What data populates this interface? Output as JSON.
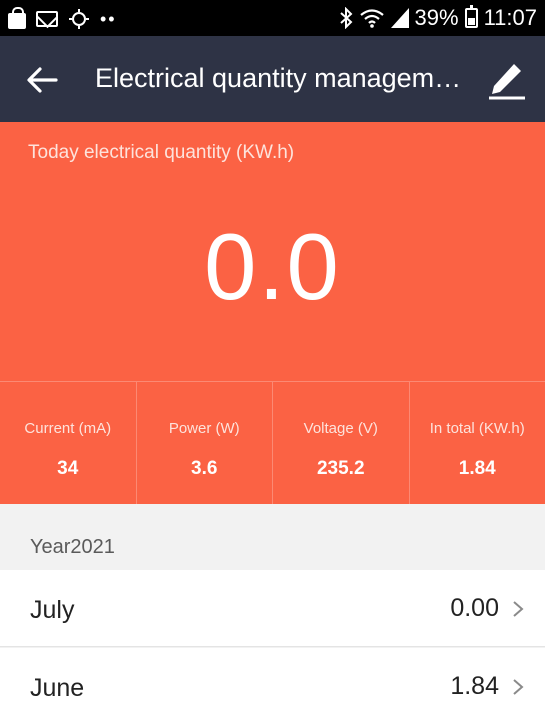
{
  "status_bar": {
    "battery_percent": "39%",
    "time": "11:07",
    "icons": [
      "shopping-bag-icon",
      "mail-icon",
      "sync-icon",
      "bluetooth-icon",
      "wifi-icon",
      "signal-icon",
      "battery-icon"
    ]
  },
  "toolbar": {
    "title": "Electrical quantity managem…",
    "back_icon": "arrow-left-icon",
    "edit_icon": "pencil-icon"
  },
  "today": {
    "label": "Today electrical quantity (KW.h)",
    "value": "0.0"
  },
  "stats": [
    {
      "label": "Current  (mA)",
      "value": "34"
    },
    {
      "label": "Power (W)",
      "value": "3.6"
    },
    {
      "label": "Voltage (V)",
      "value": "235.2"
    },
    {
      "label": "In total (KW.h)",
      "value": "1.84"
    }
  ],
  "year": {
    "label": "Year2021"
  },
  "months": [
    {
      "name": "July",
      "value": "0.00"
    },
    {
      "name": "June",
      "value": "1.84"
    }
  ],
  "colors": {
    "toolbar_bg": "#2e3345",
    "panel_bg": "#fb6244",
    "page_bg": "#f2f2f2"
  }
}
